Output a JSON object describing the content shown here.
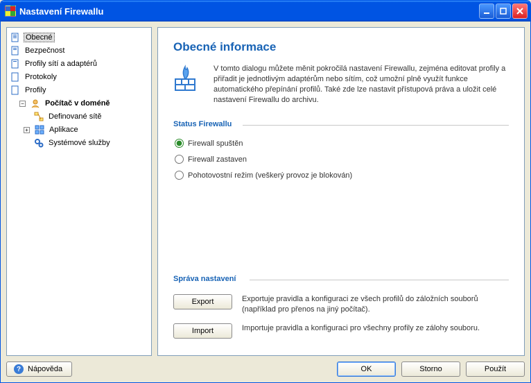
{
  "window": {
    "title": "Nastavení Firewallu"
  },
  "tree": {
    "items": [
      {
        "label": "Obecné"
      },
      {
        "label": "Bezpečnost"
      },
      {
        "label": "Profily sítí a adaptérů"
      },
      {
        "label": "Protokoly"
      },
      {
        "label": "Profily"
      },
      {
        "label": "Počítač v doméně"
      },
      {
        "label": "Definované sítě"
      },
      {
        "label": "Aplikace"
      },
      {
        "label": "Systémové služby"
      }
    ]
  },
  "page": {
    "title": "Obecné informace",
    "intro": "V tomto dialogu můžete měnit pokročilá nastavení Firewallu, zejména editovat profily a přiřadit je jednotlivým adaptérům nebo sítím, což umožní plně využít funkce automatického přepínání profilů. Také zde lze nastavit přístupová práva a uložit celé nastavení Firewallu do archivu."
  },
  "status": {
    "title": "Status Firewallu",
    "options": [
      "Firewall spuštěn",
      "Firewall zastaven",
      "Pohotovostní režim (veškerý provoz je blokován)"
    ]
  },
  "mgmt": {
    "title": "Správa nastavení",
    "export_label": "Export",
    "export_desc": "Exportuje pravidla a konfiguraci ze všech profilů do záložních souborů (například pro přenos na jiný počítač).",
    "import_label": "Import",
    "import_desc": "Importuje pravidla a konfiguraci pro všechny profily ze zálohy souboru."
  },
  "footer": {
    "help": "Nápověda",
    "ok": "OK",
    "cancel": "Storno",
    "apply": "Použít"
  }
}
